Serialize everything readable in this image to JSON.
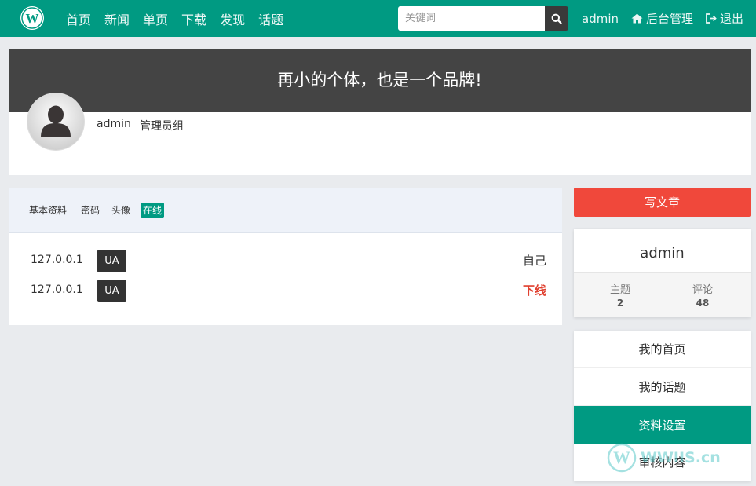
{
  "nav": {
    "items": [
      "首页",
      "新闻",
      "单页",
      "下载",
      "发现",
      "话题"
    ],
    "search_placeholder": "关键词",
    "user": "admin",
    "admin_link": "后台管理",
    "logout": "退出"
  },
  "banner": {
    "slogan": "再小的个体，也是一个品牌!",
    "username": "admin",
    "group": "管理员组"
  },
  "tabs": [
    "基本资料",
    "密码",
    "头像",
    "在线"
  ],
  "sessions": [
    {
      "ip": "127.0.0.1",
      "badge": "UA",
      "status": "自己"
    },
    {
      "ip": "127.0.0.1",
      "badge": "UA",
      "status": "下线"
    }
  ],
  "sidebar": {
    "write_button": "写文章",
    "username": "admin",
    "stats": [
      {
        "label": "主题",
        "value": "2"
      },
      {
        "label": "评论",
        "value": "48"
      }
    ],
    "menu": [
      "我的首页",
      "我的话题",
      "资料设置",
      "审核内容"
    ]
  },
  "watermark": "WWIIS.cn",
  "colors": {
    "primary": "#009a82",
    "accent": "#f0483b",
    "banner": "#444444"
  }
}
